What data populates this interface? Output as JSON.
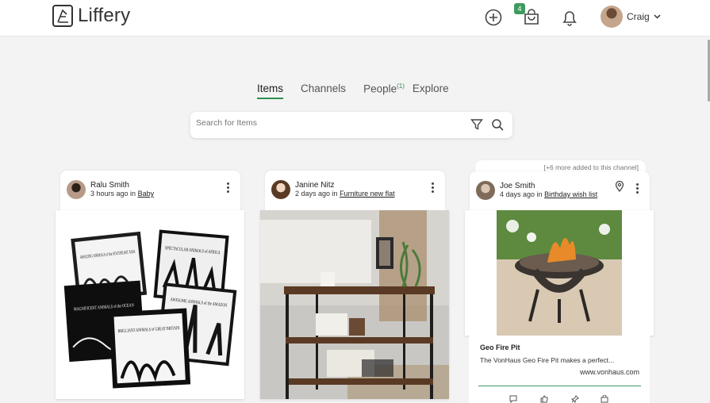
{
  "app": {
    "name": "Liffery"
  },
  "header": {
    "add_icon": "plus-circle-icon",
    "cart_icon": "shopping-bag-icon",
    "cart_count": "4",
    "bell_icon": "bell-icon",
    "user_name": "Craig"
  },
  "tabs": {
    "items": "Items",
    "channels": "Channels",
    "people": "People",
    "people_badge": "(1)",
    "explore": "Explore",
    "active": "Items"
  },
  "search": {
    "placeholder": "Search for Items",
    "value": ""
  },
  "cards": [
    {
      "user": "Ralu Smith",
      "time": "3 hours ago in",
      "channel": "Baby"
    },
    {
      "user": "Janine Nitz",
      "time": "2 days ago in",
      "channel": "Furniture new flat"
    },
    {
      "user": "Joe Smith",
      "time": "4 days ago in",
      "channel": "Birthday wish list",
      "more_note": "[+6 more added to this channel]",
      "item_title": "Geo Fire Pit",
      "item_desc": "The VonHaus Geo Fire Pit makes a perfect...",
      "item_domain": "www.vonhaus.com"
    }
  ],
  "book_titles": [
    "AMAZING ANIMALS of the SOUTHEAST ASIA",
    "SPECTACULAR ANIMALS of AFRICA",
    "MAGNIFICENT ANIMALS of the OCEAN",
    "AWESOME ANIMALS of the AMAZON",
    "BRILLIANT ANIMALS of GREAT BRITAIN"
  ],
  "colors": {
    "accent": "#2f8f52",
    "badge": "#3f9a5e",
    "background": "#f3f3f3"
  }
}
